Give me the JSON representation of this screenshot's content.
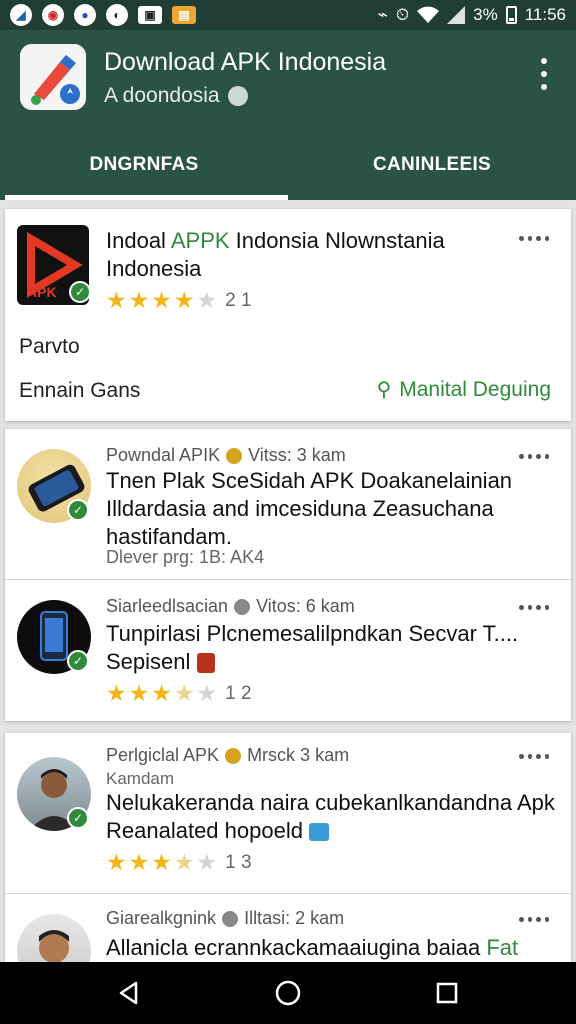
{
  "status": {
    "time": "11:56",
    "battery": "3%",
    "notifications": [
      "app-a-icon",
      "app-b-icon",
      "app-c-icon",
      "app-d-icon",
      "app-e-icon",
      "app-f-icon"
    ]
  },
  "app": {
    "title": "Download APK Indonesia",
    "subtitle": "A doondosia",
    "menu_icon": "more-vert-icon"
  },
  "tabs": [
    {
      "label": "DNGRNFAS",
      "active": true
    },
    {
      "label": "CANINLEEIS",
      "active": false
    }
  ],
  "featured": {
    "title_part1": "Indoal ",
    "title_highlight": "APPK",
    "title_part2": " Indonsia Nlownstania Indonesia",
    "rating_count": "2 1",
    "stars": 4,
    "label": "Parvto",
    "footer_left": "Ennain Gans",
    "footer_right": "Manital Deguing"
  },
  "posts": [
    {
      "author": "Powndal APIK",
      "views": "Vitss: 3 kam",
      "title": "Tnen Plak SceSidah APK Doakanelainian Illdardasia and imcesiduna Zeasuchana hastifandam.",
      "footer": "Dlever prg: 1B: AK4"
    },
    {
      "author": "Siarleedlsacian",
      "views": "Vitos: 6 kam",
      "title": "Tunpirlasi Plcnemesalilpndkan Secvar T.... Sepisenl",
      "rating_count": "1 2",
      "stars": 3
    },
    {
      "author": "Perlgiclal APK",
      "views": "Mrsck 3 kam",
      "author_sub": "Kamdam",
      "title": "Nelukakeranda naira cubekanlkandandna Apk Reanalated hopoeld",
      "rating_count": "1 3",
      "stars": 3
    },
    {
      "author": "Giarealkgnink",
      "views": "Illtasi: 2 kam",
      "title_part": "Allanicla ecrannkackamaaiugina baiaa ",
      "title_highlight": "Fat"
    }
  ],
  "colors": {
    "header": "#2a5246",
    "status_bar": "#213e36",
    "accent_green": "#2e8b3a",
    "star": "#f2b617"
  }
}
